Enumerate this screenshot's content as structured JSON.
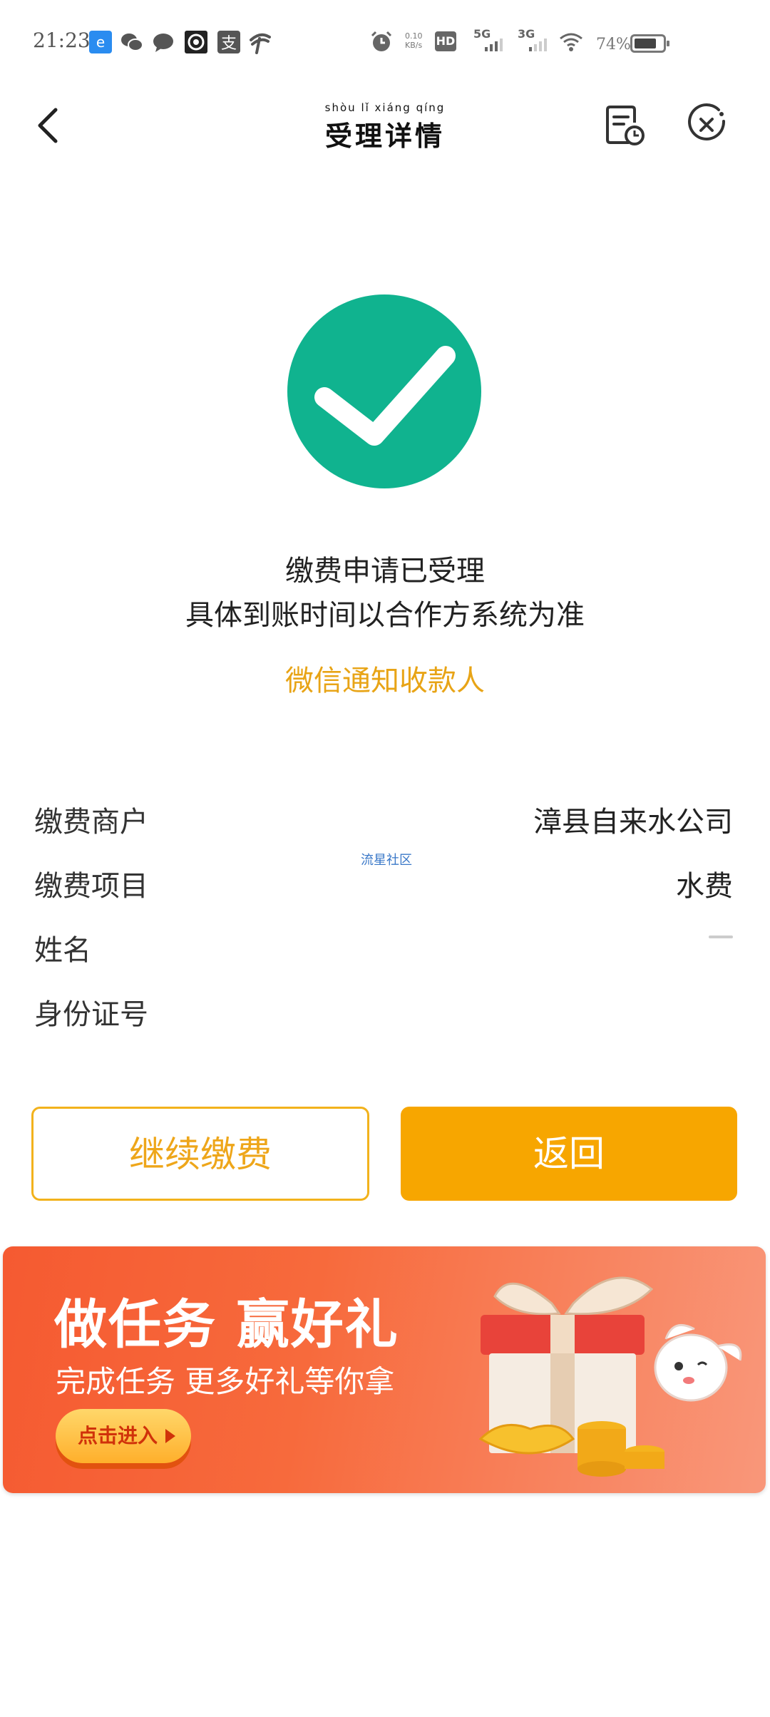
{
  "status_bar": {
    "time": "21:23",
    "net_speed": "0.10\nKB/s",
    "signal_5g": "5G",
    "signal_3g": "3G",
    "hd": "HD",
    "battery": "74%"
  },
  "nav": {
    "pinyin": "shòu  lǐ  xiáng  qíng",
    "title": "受理详情"
  },
  "result": {
    "line1": "缴费申请已受理",
    "line2": "具体到账时间以合作方系统为准",
    "notify_link": "微信通知收款人"
  },
  "details": {
    "merchant_label": "缴费商户",
    "merchant_value": "漳县自来水公司",
    "item_label": "缴费项目",
    "item_value": "水费",
    "name_label": "姓名",
    "name_value": "",
    "id_label": "身份证号",
    "id_value": ""
  },
  "watermark": "流星社区",
  "buttons": {
    "continue": "继续缴费",
    "back": "返回"
  },
  "banner": {
    "title": "做任务 赢好礼",
    "subtitle": "完成任务 更多好礼等你拿",
    "cta": "点击进入"
  },
  "colors": {
    "success_green": "#10b38f",
    "accent_yellow": "#f7a600",
    "link_yellow": "#e8a416",
    "banner_orange": "#f55a31"
  }
}
